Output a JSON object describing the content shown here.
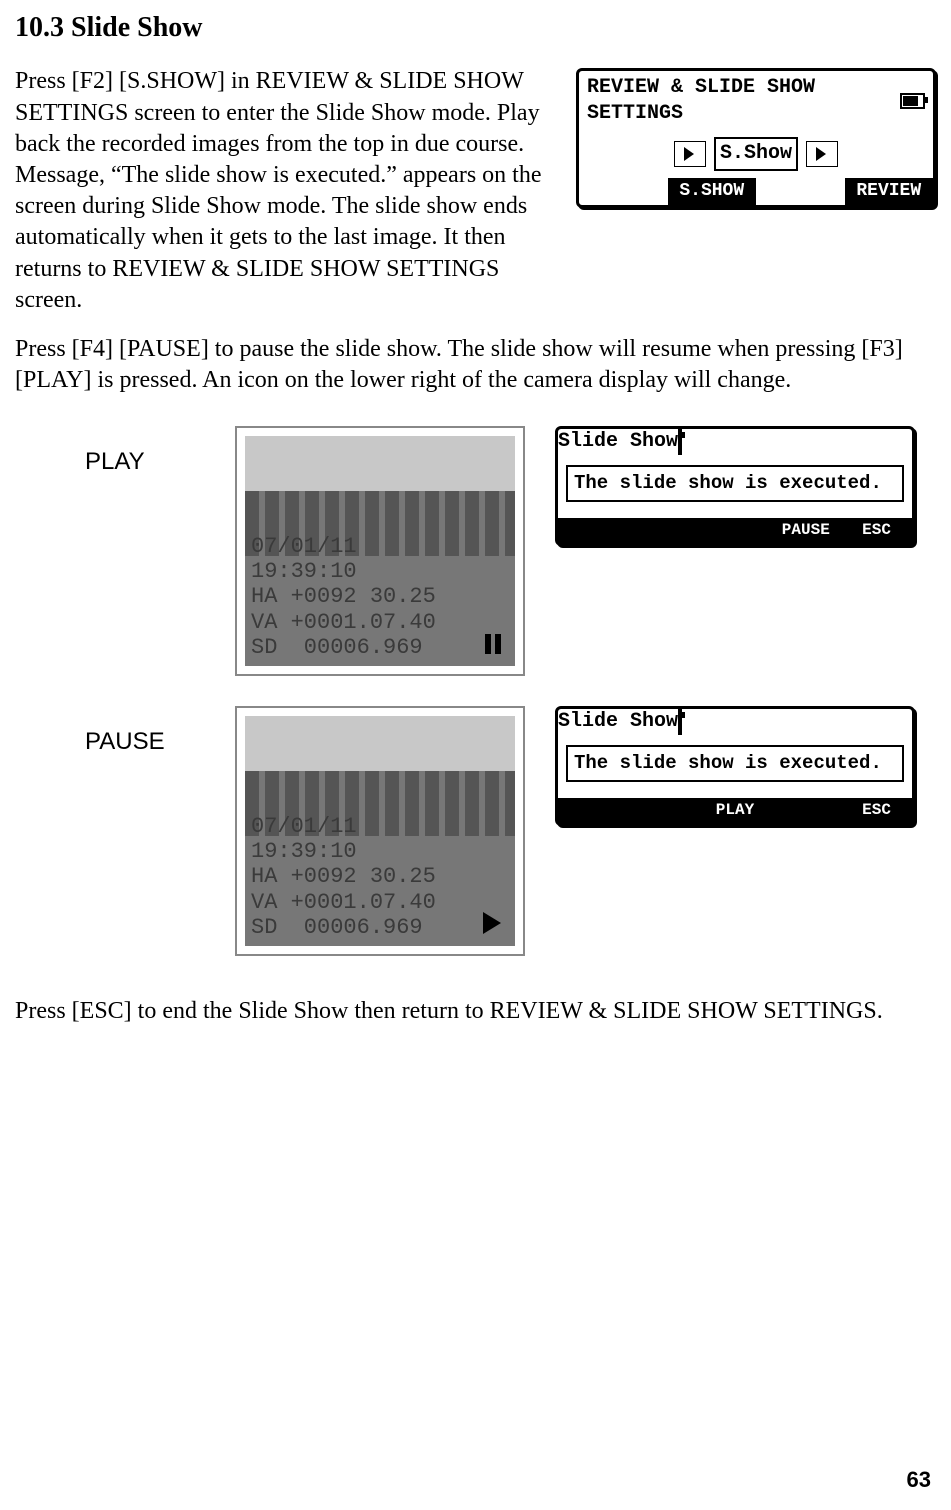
{
  "heading": "10.3 Slide Show",
  "para1": "Press [F2] [S.SHOW] in REVIEW & SLIDE SHOW SETTINGS screen to enter the Slide Show mode. Play back the recorded images from the top in due course. Message, “The slide show is executed.” appears on the screen during Slide Show mode. The slide show ends  automatically when it gets to the last image. It then returns to REVIEW & SLIDE SHOW SETTINGS screen.",
  "para2": "Press [F4] [PAUSE] to pause the slide show. The slide show will resume when pressing [F3] [PLAY] is pressed. An icon on the lower right of the camera display will change.",
  "para3": "Press [ESC] to end the Slide Show then return to REVIEW & SLIDE SHOW SETTINGS.",
  "pageNumber": "63",
  "settingsLcd": {
    "title": "REVIEW & SLIDE SHOW SETTINGS",
    "center": "S.Show",
    "softkeys": [
      "",
      "S.SHOW",
      "",
      "REVIEW"
    ]
  },
  "photoOverlay": {
    "line1": "07/01/11",
    "line2": "19:39:10",
    "line3": "HA +0092 30.25",
    "line4": "VA +0001.07.40",
    "line5": "SD  00006.969"
  },
  "playLabel": "PLAY",
  "pauseLabel": "PAUSE",
  "slideLcdPlay": {
    "title": "Slide Show",
    "msg": "The slide show is executed.",
    "softkeys": [
      "",
      "",
      "",
      "PAUSE",
      "ESC"
    ]
  },
  "slideLcdPause": {
    "title": "Slide Show",
    "msg": "The slide show is executed.",
    "softkeys": [
      "",
      "",
      "PLAY",
      "",
      "ESC"
    ]
  }
}
